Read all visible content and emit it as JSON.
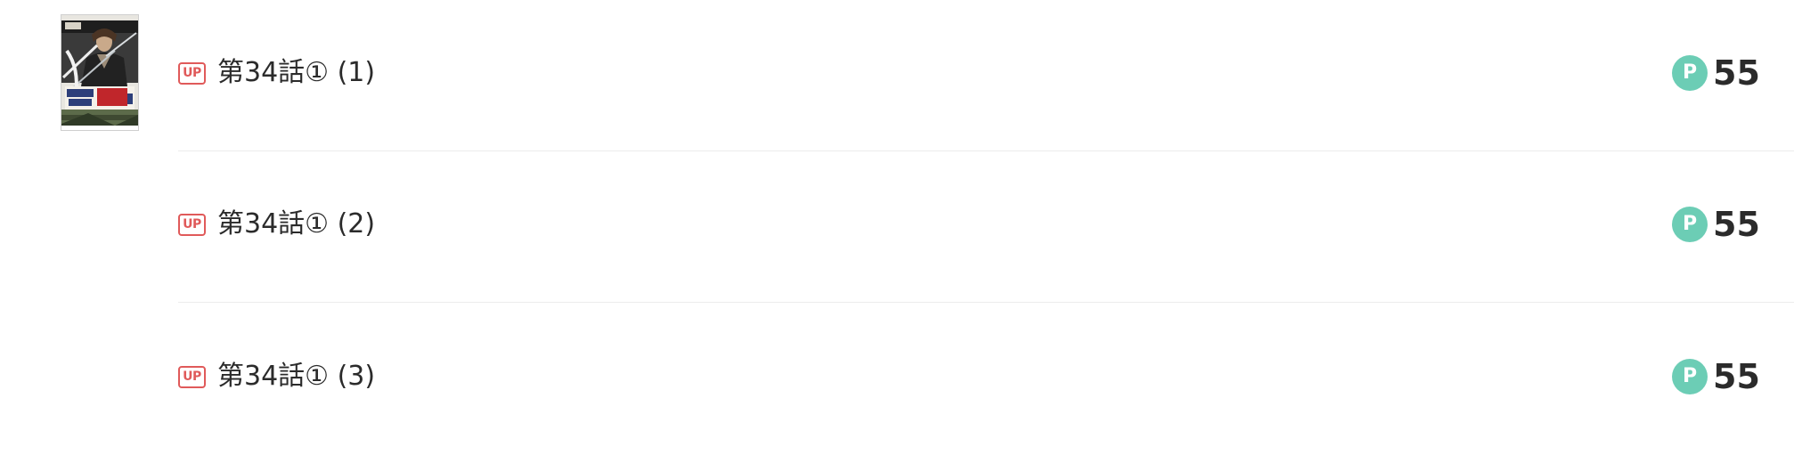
{
  "cover": {
    "alt_text": "連載 天才剣士 剣聖",
    "icon": "manga-cover-image"
  },
  "episodes": [
    {
      "badge": "UP",
      "title": "第34話① (1)",
      "currency_icon": "P",
      "price": "55"
    },
    {
      "badge": "UP",
      "title": "第34話① (2)",
      "currency_icon": "P",
      "price": "55"
    },
    {
      "badge": "UP",
      "title": "第34話① (3)",
      "currency_icon": "P",
      "price": "55"
    }
  ],
  "colors": {
    "up_badge": "#e05a5a",
    "point_icon": "#6ccdb5",
    "divider": "#ececec",
    "text": "#2b2b2b"
  }
}
